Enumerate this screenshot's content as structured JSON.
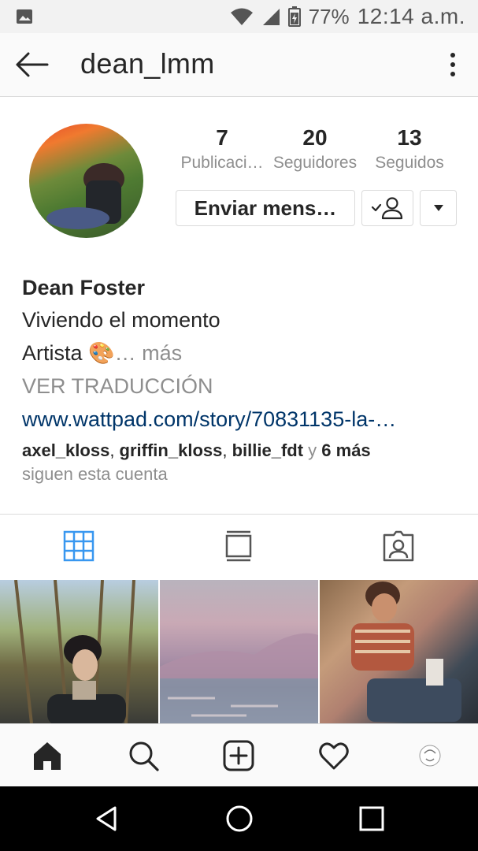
{
  "status_bar": {
    "battery": "77%",
    "time": "12:14 a.m.",
    "icons": [
      "image-icon",
      "wifi-icon",
      "signal-icon",
      "battery-icon"
    ]
  },
  "header": {
    "username": "dean_lmm",
    "back_icon": "arrow-left-icon",
    "menu_icon": "more-vert-icon"
  },
  "profile": {
    "stats": [
      {
        "value": "7",
        "label": "Publicaci…"
      },
      {
        "value": "20",
        "label": "Seguidores"
      },
      {
        "value": "13",
        "label": "Seguidos"
      }
    ],
    "message_button": "Enviar mens…",
    "follow_icon": "following-check-icon",
    "dropdown_icon": "caret-down-icon"
  },
  "bio": {
    "name": "Dean Foster",
    "line1": "Viviendo el momento",
    "line2": "Artista 🎨",
    "more": "… más",
    "translate": "VER TRADUCCIÓN",
    "link": "www.wattpad.com/story/70831135-la-…",
    "followed_by": {
      "user1": "axel_kloss",
      "sep1": ", ",
      "user2": "griffin_kloss",
      "sep2": ", ",
      "user3": "billie_fdt",
      "conj": " y ",
      "more": "6 más",
      "line2": "siguen esta cuenta"
    }
  },
  "tabs": [
    "grid-icon",
    "feed-icon",
    "tagged-icon"
  ],
  "accent_color": "#3897f0",
  "link_color": "#003569",
  "bottom_nav": [
    "home-icon",
    "search-icon",
    "add-post-icon",
    "heart-icon",
    "profile-avatar-icon"
  ]
}
